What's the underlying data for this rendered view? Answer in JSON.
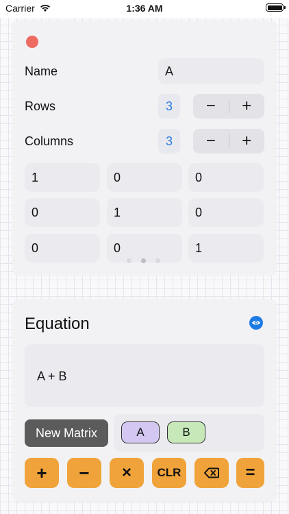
{
  "status_bar": {
    "carrier": "Carrier",
    "time": "1:36 AM"
  },
  "matrix_editor": {
    "name_label": "Name",
    "name_value": "A",
    "rows_label": "Rows",
    "rows_value": "3",
    "columns_label": "Columns",
    "columns_value": "3",
    "stepper": {
      "decrement": "−",
      "increment": "+"
    },
    "cells": [
      [
        "1",
        "0",
        "0"
      ],
      [
        "0",
        "1",
        "0"
      ],
      [
        "0",
        "0",
        "1"
      ]
    ],
    "page_count": 3,
    "current_page": 2
  },
  "equation": {
    "title": "Equation",
    "expression": "A + B",
    "new_matrix_label": "New Matrix",
    "matrices": [
      "A",
      "B"
    ],
    "keys": {
      "plus": "+",
      "minus": "−",
      "times": "×",
      "clear": "CLR",
      "backspace": "⌫",
      "equals": "="
    }
  },
  "colors": {
    "accent": "#2D7BE0",
    "key_orange": "#F0A33A",
    "chip_a": "#D4C8F2",
    "chip_b": "#C7E8B9",
    "close_red": "#EE6B62",
    "dark_button": "#5B5B5B"
  },
  "icons": {
    "wifi": "wifi-icon",
    "battery": "battery-icon",
    "close": "close-dot-icon",
    "visibility": "eye-icon",
    "backspace": "backspace-icon"
  }
}
